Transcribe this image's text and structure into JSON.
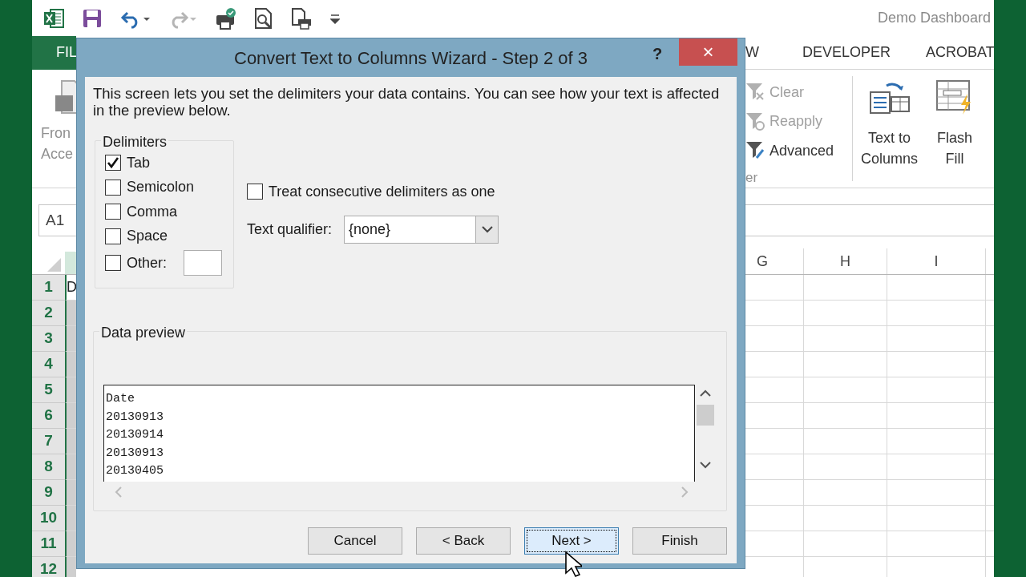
{
  "app": {
    "title": "Demo Dashboard"
  },
  "ribbon_tabs": [
    {
      "label": "FIL",
      "selected": true
    },
    {
      "label": "W",
      "selected": false
    },
    {
      "label": "DEVELOPER",
      "selected": false
    },
    {
      "label": "ACROBAT",
      "selected": false
    }
  ],
  "get_data": {
    "lines": [
      "Fron",
      "Acce"
    ]
  },
  "sort_filter": {
    "group_label": "er",
    "items": [
      {
        "label": "Clear",
        "disabled": true
      },
      {
        "label": "Reapply",
        "disabled": true
      },
      {
        "label": "Advanced",
        "disabled": false
      }
    ]
  },
  "data_tools": [
    {
      "kind": "columns",
      "lines": [
        "Text to",
        "Columns"
      ]
    },
    {
      "kind": "flash",
      "lines": [
        "Flash",
        "Fill"
      ]
    }
  ],
  "name_box": "A1",
  "columns": [
    "G",
    "H",
    "I"
  ],
  "rows": [
    "1",
    "2",
    "3",
    "4",
    "5",
    "6",
    "7",
    "8",
    "9",
    "10",
    "11",
    "12"
  ],
  "cell_a1": "D",
  "dialog": {
    "title": "Convert Text to Columns Wizard - Step 2 of 3",
    "help": "?",
    "close": "×",
    "intro": "This screen lets you set the delimiters your data contains.  You can see how your text is affected in the preview below.",
    "delimiters_title": "Delimiters",
    "delimiters": [
      {
        "label": "Tab",
        "checked": true
      },
      {
        "label": "Semicolon",
        "checked": false
      },
      {
        "label": "Comma",
        "checked": false
      },
      {
        "label": "Space",
        "checked": false
      },
      {
        "label": "Other:",
        "checked": false
      }
    ],
    "consecutive": {
      "label": "Treat consecutive delimiters as one",
      "checked": false
    },
    "qualifier": {
      "label": "Text qualifier:",
      "value": "{none}"
    },
    "preview_title": "Data preview",
    "preview_lines": [
      "Date",
      "20130913",
      "20130914",
      "20130913",
      "20130405"
    ],
    "buttons": [
      {
        "label": "Cancel",
        "focused": false
      },
      {
        "label": "< Back",
        "focused": false
      },
      {
        "label": "Next >",
        "focused": true
      },
      {
        "label": "Finish",
        "focused": false
      }
    ]
  }
}
